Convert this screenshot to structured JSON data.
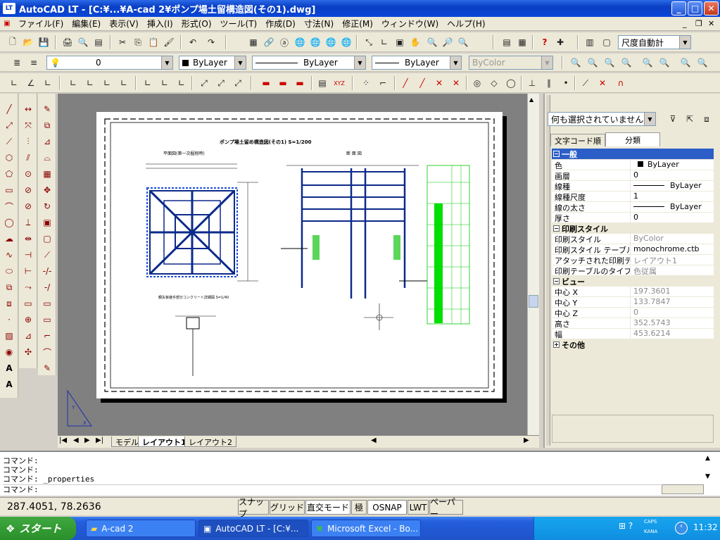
{
  "window": {
    "title": "AutoCAD LT - [C:¥...¥A-cad 2¥ポンプ場土留構造図(その1).dwg]"
  },
  "menu": [
    "ファイル(F)",
    "編集(E)",
    "表示(V)",
    "挿入(I)",
    "形式(O)",
    "ツール(T)",
    "作成(D)",
    "寸法(N)",
    "修正(M)",
    "ウィンドウ(W)",
    "ヘルプ(H)"
  ],
  "toolbar": {
    "scale_combo": "尺度自動計",
    "layer_combo": "0",
    "color_combo": "ByLayer",
    "linetype_combo": "ByLayer",
    "lineweight_combo": "ByLayer",
    "plotstyle_combo": "ByColor"
  },
  "drawing": {
    "title": "ポンプ場土留め構造図(その1)  S=1/200",
    "plan_label": "平面図(第一次掘削時)",
    "section_label": "断 面 図",
    "detail_label": "鋼矢板継手部分コンクリート詳細図 S=1/40"
  },
  "layout_tabs": [
    "モデル",
    "レイアウト1",
    "レイアウト2"
  ],
  "properties": {
    "selection": "何も選択されていません",
    "tabs": [
      "文字コード順",
      "分類"
    ],
    "categories": {
      "general": "一般",
      "plot": "印刷スタイル",
      "view": "ビュー",
      "other": "その他"
    },
    "general": [
      {
        "k": "色",
        "v": "ByLayer"
      },
      {
        "k": "画層",
        "v": "0"
      },
      {
        "k": "線種",
        "v": "ByLayer"
      },
      {
        "k": "線種尺度",
        "v": "1"
      },
      {
        "k": "線の太さ",
        "v": "ByLayer"
      },
      {
        "k": "厚さ",
        "v": "0"
      }
    ],
    "plot": [
      {
        "k": "印刷スタイル",
        "v": "ByColor"
      },
      {
        "k": "印刷スタイル テーブル",
        "v": "monochrome.ctb"
      },
      {
        "k": "アタッチされた印刷テーブル",
        "v": "レイアウト1"
      },
      {
        "k": "印刷テーブルのタイプ",
        "v": "色従属"
      }
    ],
    "view": [
      {
        "k": "中心 X",
        "v": "197.3601"
      },
      {
        "k": "中心 Y",
        "v": "133.7847"
      },
      {
        "k": "中心 Z",
        "v": "0"
      },
      {
        "k": "高さ",
        "v": "352.5743"
      },
      {
        "k": "幅",
        "v": "453.6214"
      }
    ]
  },
  "command": {
    "lines": [
      "コマンド:",
      "コマンド:",
      "コマンド:  _properties"
    ],
    "prompt": "コマンド:"
  },
  "status": {
    "coords": "287.4051, 78.2636",
    "buttons": [
      "スナップ",
      "グリッド",
      "直交モード",
      "極",
      "OSNAP",
      "LWT",
      "ペーパー"
    ]
  },
  "taskbar": {
    "start": "スタート",
    "tasks": [
      "A-cad 2",
      "AutoCAD LT - [C:¥...",
      "Microsoft Excel - Bo..."
    ],
    "ime": "あ 般",
    "caps": "CAPS",
    "kana": "KANA",
    "clock": "11:32"
  }
}
